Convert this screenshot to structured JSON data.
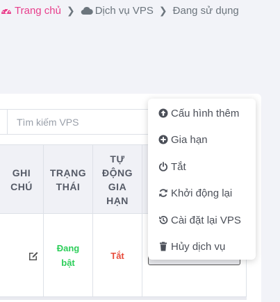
{
  "breadcrumb": {
    "home": "Trang chủ",
    "service": "Dịch vụ VPS",
    "current": "Đang sử dụng"
  },
  "search": {
    "placeholder": "Tìm kiếm VPS"
  },
  "table": {
    "headers": {
      "note": [
        "GHI",
        "CHÚ"
      ],
      "status": [
        "TRẠNG",
        "THÁI"
      ],
      "auto_renew": [
        "TỰ",
        "ĐỘNG",
        "GIA",
        "HẠN"
      ]
    },
    "row": {
      "status": [
        "Đang",
        "bật"
      ],
      "auto_renew": "Tắt"
    }
  },
  "menu": {
    "items": [
      {
        "label": "Cấu hình thêm",
        "icon": "arrow-up-circle-icon"
      },
      {
        "label": "Gia hạn",
        "icon": "plus-circle-icon"
      },
      {
        "label": "Tắt",
        "icon": "power-icon"
      },
      {
        "label": "Khởi động lại",
        "icon": "refresh-icon"
      },
      {
        "label": "Cài đặt lại VPS",
        "icon": "history-icon"
      },
      {
        "label": "Hủy dịch vụ",
        "icon": "trash-icon"
      }
    ]
  },
  "colors": {
    "accent_pink": "#e83e8c",
    "status_green": "#2dce5a",
    "status_red": "#e74c3c"
  }
}
